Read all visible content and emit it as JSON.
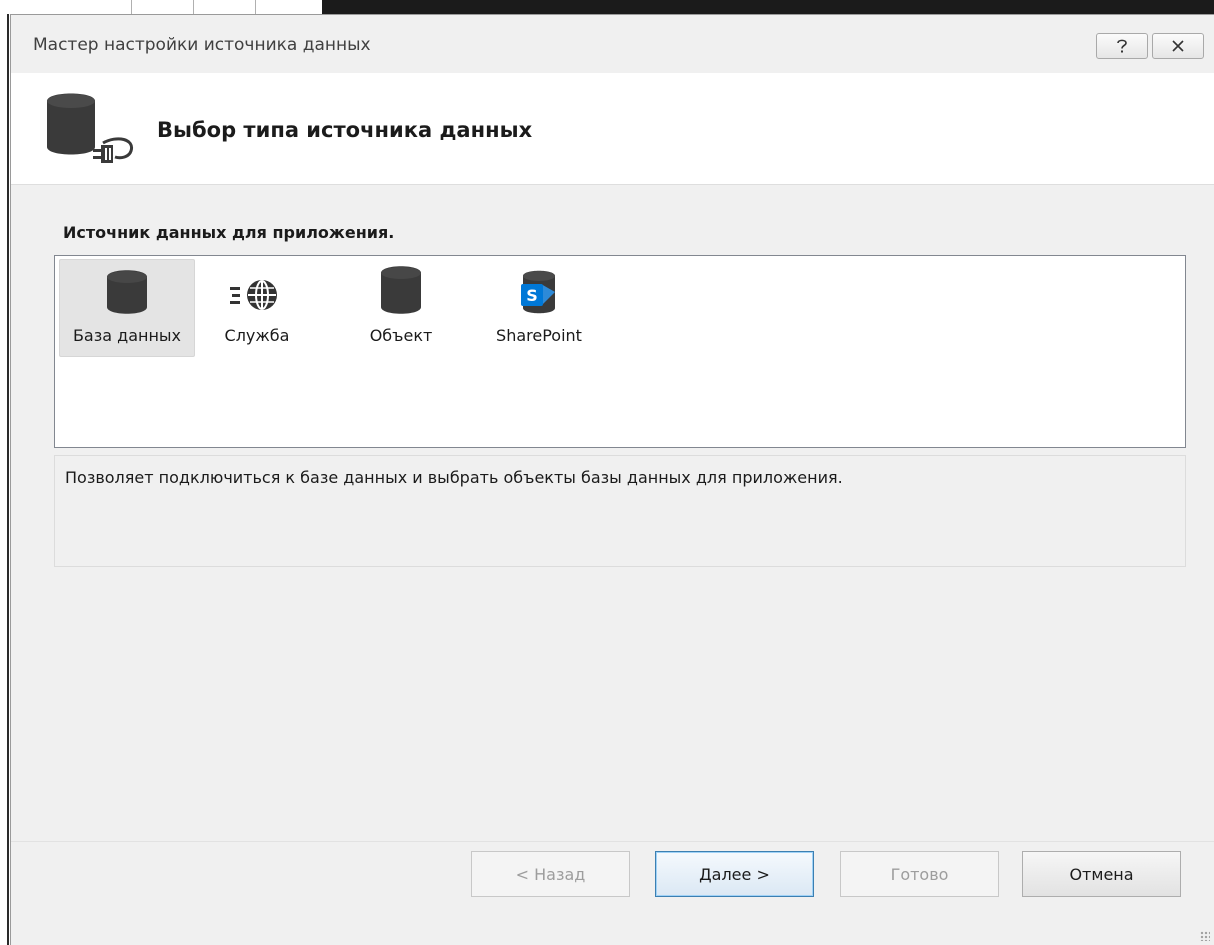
{
  "window": {
    "title": "Мастер настройки источника данных",
    "help_icon": "help-icon",
    "close_icon": "close-icon"
  },
  "header": {
    "icon": "database-connect-icon",
    "title": "Выбор типа источника данных"
  },
  "main": {
    "section_label": "Источник данных для приложения.",
    "source_types": [
      {
        "label": "База данных",
        "icon": "database-icon",
        "selected": true
      },
      {
        "label": "Служба",
        "icon": "web-service-icon",
        "selected": false
      },
      {
        "label": "Объект",
        "icon": "object-icon",
        "selected": false
      },
      {
        "label": "SharePoint",
        "icon": "sharepoint-icon",
        "selected": false
      }
    ],
    "description": "Позволяет подключиться к базе данных и выбрать объекты базы данных для приложения."
  },
  "footer": {
    "back_label": "< Назад",
    "next_label": "Далее >",
    "finish_label": "Готово",
    "cancel_label": "Отмена"
  },
  "colors": {
    "dialog_bg": "#f0f0f0",
    "default_button_border": "#3c7fb1",
    "sharepoint_blue": "#0078d7"
  }
}
